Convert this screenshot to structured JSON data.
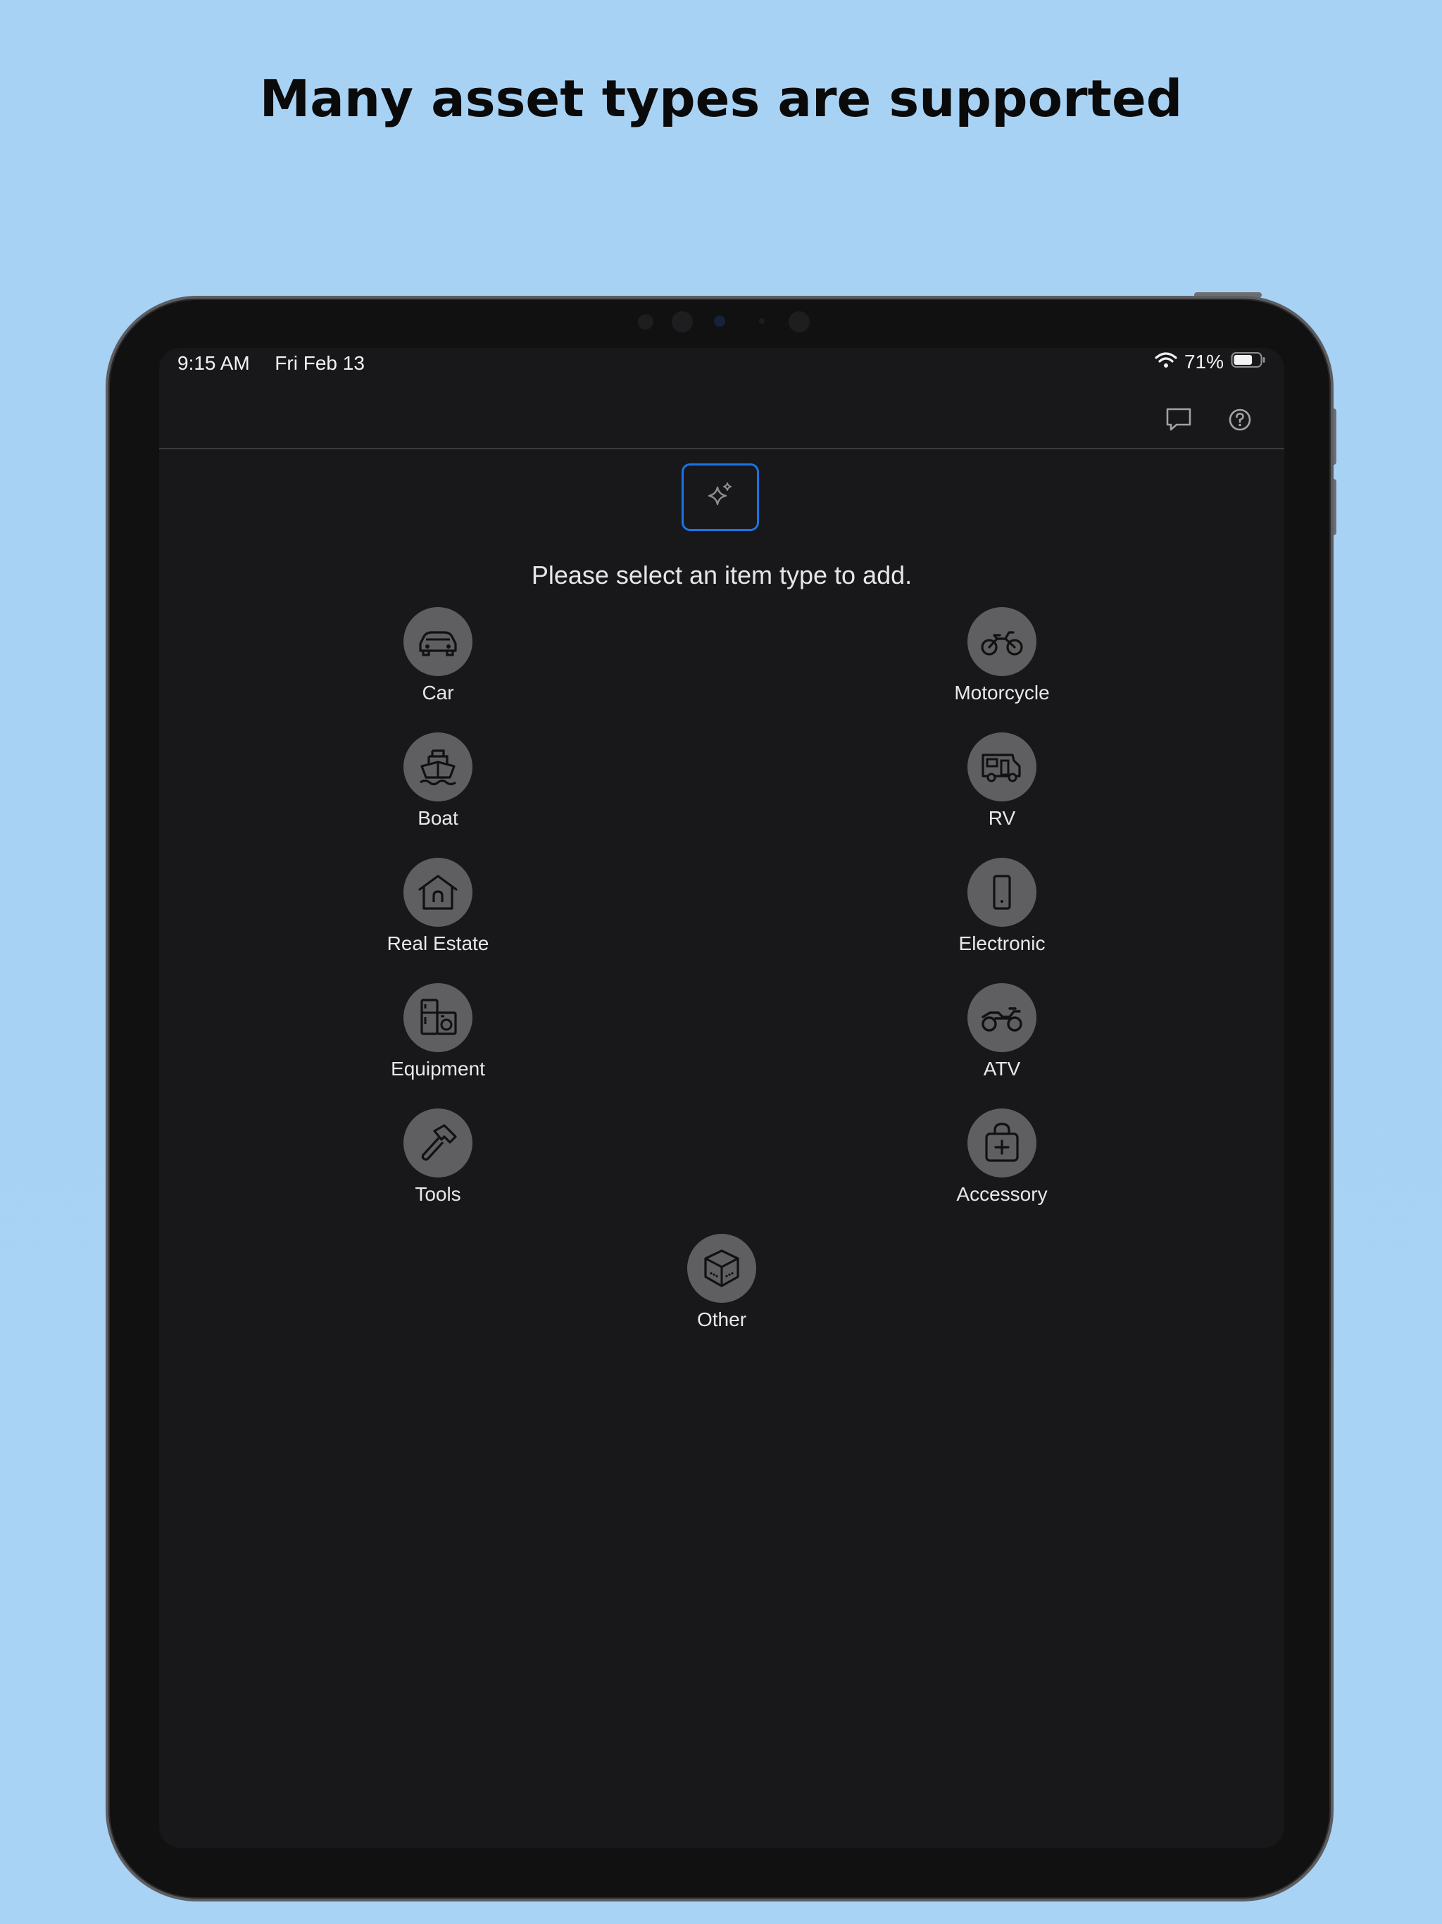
{
  "headline": "Many asset types are supported",
  "status_bar": {
    "time": "9:15 AM",
    "date": "Fri Feb 13",
    "battery": "71%",
    "battery_level": 0.71,
    "wifi_icon": "wifi-icon",
    "battery_icon": "battery-icon"
  },
  "nav": {
    "chat_icon": "chat-bubble-icon",
    "help_icon": "question-circle-icon"
  },
  "ai_button": {
    "icon": "sparkle-icon",
    "accent": "#1b74e4"
  },
  "prompt": "Please select an item type to add.",
  "item_types": [
    {
      "label": "Car",
      "icon": "car-icon"
    },
    {
      "label": "Motorcycle",
      "icon": "motorcycle-icon"
    },
    {
      "label": "Boat",
      "icon": "boat-icon"
    },
    {
      "label": "RV",
      "icon": "rv-icon"
    },
    {
      "label": "Real Estate",
      "icon": "house-icon"
    },
    {
      "label": "Electronic",
      "icon": "phone-icon"
    },
    {
      "label": "Equipment",
      "icon": "appliances-icon"
    },
    {
      "label": "ATV",
      "icon": "atv-icon"
    },
    {
      "label": "Tools",
      "icon": "hammer-icon"
    },
    {
      "label": "Accessory",
      "icon": "bag-plus-icon"
    },
    {
      "label": "Other",
      "icon": "box-icon"
    }
  ],
  "colors": {
    "page_background": "#a8d2f4",
    "screen_background": "#18181a",
    "tile_circle": "#5f5f61"
  }
}
